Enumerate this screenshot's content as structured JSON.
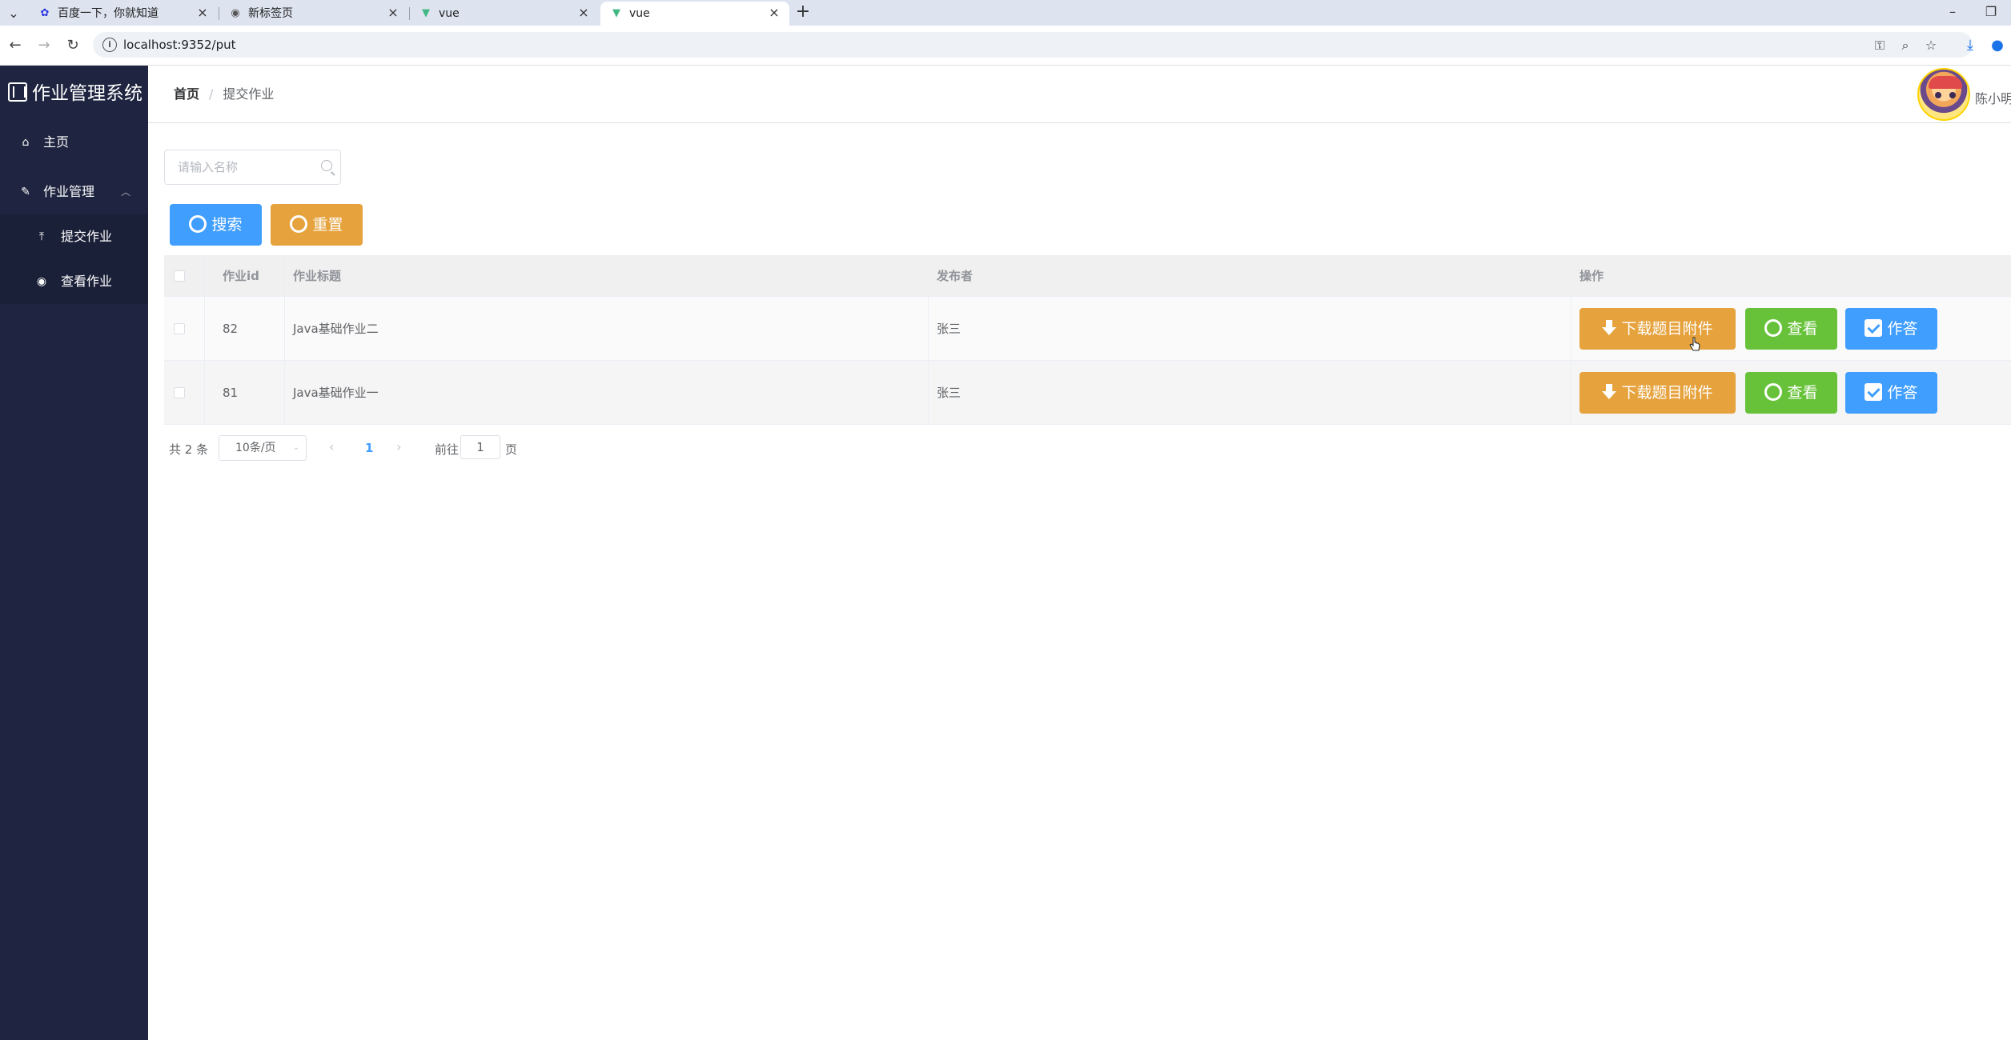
{
  "browser": {
    "tabs": [
      {
        "title": "百度一下，你就知道",
        "favicon": "baidu-paw-icon"
      },
      {
        "title": "新标签页",
        "favicon": "chrome-icon"
      },
      {
        "title": "vue",
        "favicon": "vue-icon"
      },
      {
        "title": "vue",
        "favicon": "vue-icon",
        "active": true
      }
    ],
    "url": "localhost:9352/put"
  },
  "sidebar": {
    "logo": "作业管理系统",
    "items": [
      {
        "label": "主页",
        "icon": "home-icon"
      },
      {
        "label": "作业管理",
        "icon": "edit-icon",
        "expanded": true
      },
      {
        "label": "提交作业",
        "icon": "upload-icon"
      },
      {
        "label": "查看作业",
        "icon": "eye-icon"
      }
    ]
  },
  "header": {
    "breadcrumb": [
      "首页",
      "提交作业"
    ],
    "separator": "/",
    "username": "陈小明"
  },
  "search": {
    "placeholder": "请输入名称",
    "search_label": "搜索",
    "reset_label": "重置"
  },
  "table": {
    "columns": [
      "作业id",
      "作业标题",
      "发布者",
      "操作"
    ],
    "rows": [
      {
        "id": "82",
        "title": "Java基础作业二",
        "publisher": "张三"
      },
      {
        "id": "81",
        "title": "Java基础作业一",
        "publisher": "张三"
      }
    ],
    "actions": {
      "download": "下载题目附件",
      "view": "查看",
      "answer": "作答"
    }
  },
  "pagination": {
    "total": "共 2 条",
    "page_size": "10条/页",
    "current_page": "1",
    "goto_label": "前往",
    "goto_value": "1",
    "page_unit": "页"
  },
  "colors": {
    "sidebar_bg": "#1f2540",
    "primary": "#409eff",
    "warning": "#e6a23c",
    "success": "#67c23a"
  }
}
